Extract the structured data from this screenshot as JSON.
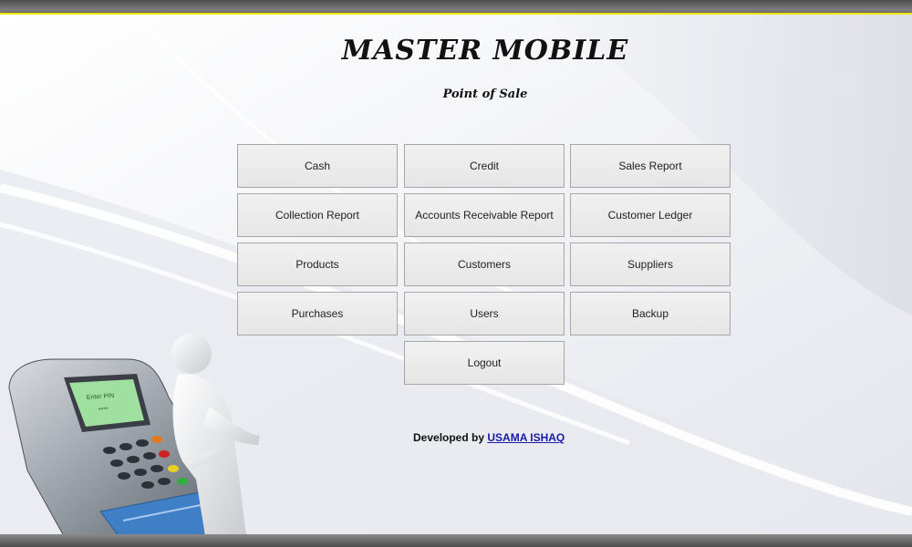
{
  "header": {
    "title": "MASTER MOBILE",
    "subtitle": "Point of Sale"
  },
  "menu": [
    {
      "label": "Cash"
    },
    {
      "label": "Credit"
    },
    {
      "label": "Sales Report"
    },
    {
      "label": "Collection Report"
    },
    {
      "label": "Accounts Receivable Report"
    },
    {
      "label": "Customer Ledger"
    },
    {
      "label": "Products"
    },
    {
      "label": "Customers"
    },
    {
      "label": "Suppliers"
    },
    {
      "label": "Purchases"
    },
    {
      "label": "Users"
    },
    {
      "label": "Backup"
    },
    {
      "label": "Logout"
    }
  ],
  "footer": {
    "developed_by": "Developed by",
    "developer_name": "USAMA ISHAQ"
  },
  "illustration": {
    "terminal_screen_text": "Enter PIN",
    "terminal_screen_code": "****"
  },
  "colors": {
    "accent_top_border": "#f2e600",
    "link": "#1a1aa8",
    "button_bg": "#ececec",
    "card": "#3f7fc6"
  }
}
